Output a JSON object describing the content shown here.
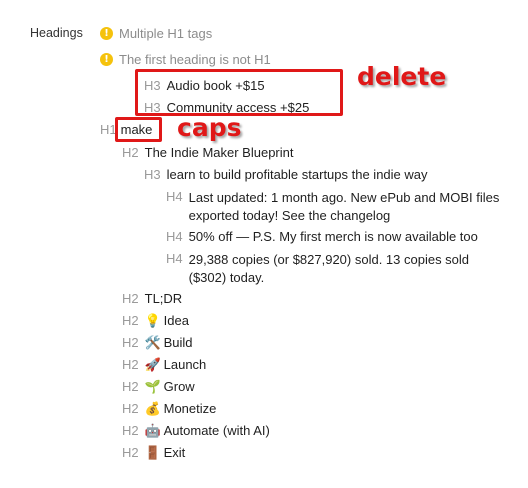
{
  "section_label": "Headings",
  "warnings": [
    {
      "text": "Multiple H1 tags",
      "icon": "info-icon"
    },
    {
      "text": "The first heading is not H1",
      "icon": "info-icon"
    }
  ],
  "headings": [
    {
      "tag": "H3",
      "text": "Audio book +$15"
    },
    {
      "tag": "H3",
      "text": "Community access +$25"
    },
    {
      "tag": "H1",
      "text": "make"
    },
    {
      "tag": "H2",
      "text": "The Indie Maker Blueprint"
    },
    {
      "tag": "H3",
      "text": "learn to build profitable startups the indie way"
    },
    {
      "tag": "H4",
      "text": "Last updated: 1 month ago. New ePub and MOBI files exported today! See the changelog"
    },
    {
      "tag": "H4",
      "text": "50% off — P.S. My first merch is now available too"
    },
    {
      "tag": "H4",
      "text": "29,388 copies (or $827,920) sold. 13 copies sold ($302) today."
    },
    {
      "tag": "H2",
      "text": "TL;DR"
    },
    {
      "tag": "H2",
      "emoji": "💡",
      "text": "Idea"
    },
    {
      "tag": "H2",
      "emoji": "🛠️",
      "text": "Build"
    },
    {
      "tag": "H2",
      "emoji": "🚀",
      "text": "Launch"
    },
    {
      "tag": "H2",
      "emoji": "🌱",
      "text": "Grow"
    },
    {
      "tag": "H2",
      "emoji": "💰",
      "text": "Monetize"
    },
    {
      "tag": "H2",
      "emoji": "🤖",
      "text": "Automate (with AI)"
    },
    {
      "tag": "H2",
      "emoji": "🚪",
      "text": "Exit"
    }
  ],
  "annotations": {
    "delete": "delete",
    "caps": "caps"
  },
  "colors": {
    "annotation": "#e01818",
    "warning": "#f5c20c",
    "tag": "#9a9a9a"
  }
}
